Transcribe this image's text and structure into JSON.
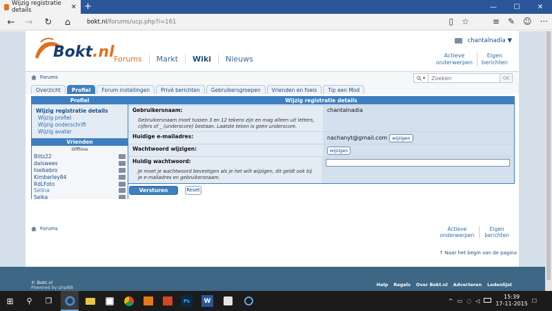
{
  "browser": {
    "tab_title": "Wijzig registratie details",
    "tab_close": "✕",
    "new_tab": "+",
    "url_host": "bokt.nl",
    "url_path": "/forums/ucp.php?i=161",
    "back": "←",
    "forward": "→",
    "refresh": "↻",
    "home": "⌂",
    "reading_view": "▯",
    "favorite": "☆",
    "hub": "≡",
    "note": "✎",
    "share": "☺",
    "more": "···",
    "minimize": "—",
    "maximize": "☐",
    "close": "✕"
  },
  "header": {
    "logo_text": "Bokt",
    "logo_suffix": ".nl",
    "nav": [
      "Forums",
      "Markt",
      "Wiki",
      "Nieuws"
    ],
    "username": "chantalnadia",
    "user_caret": "▼",
    "quick_links": [
      {
        "line1": "Actieve",
        "line2": "onderwerpen"
      },
      {
        "line1": "Eigen",
        "line2": "berichten"
      }
    ]
  },
  "subheader": {
    "breadcrumb": "Forums",
    "search_placeholder": "Zoeken",
    "search_ok": "OK",
    "search_icon_caret": "▾",
    "tabs": [
      "Overzicht",
      "Profiel",
      "Forum instellingen",
      "Privé berichten",
      "Gebruikersgroepen",
      "Vrienden en foeis",
      "Tip een Mod"
    ]
  },
  "left_panel": {
    "profile_heading": "Profiel",
    "links": [
      "Wijzig registratie details",
      "Wijzig profiel",
      "Wijzig onderschrift",
      "Wijzig avatar"
    ],
    "friends_heading": "Vrienden",
    "offline_label": "Offline",
    "friends": [
      "Blitz22",
      "daiswees",
      "hielkebro",
      "Kimberley84",
      "RdLFoto",
      "Selina",
      "Selka"
    ]
  },
  "form": {
    "heading": "Wijzig registratie details",
    "username_label": "Gebruikersnaam:",
    "username_hint": "Gebruikersnaam moet tussen 3 en 12 tekens zijn en mag alleen uit letters, cijfers of _ (underscore) bestaan. Laatste teken is geen underscore.",
    "username_value": "chantalnadia",
    "email_label": "Huidige e-mailadres:",
    "email_value": "nachanyt@gmail.com",
    "change_button": "wijzigen",
    "password_label": "Wachtwoord wijzigen:",
    "current_password_label": "Huidig wachtwoord:",
    "current_password_hint": "Je moet je wachtwoord bevestigen als je het wilt wijzigen, dit geldt ook bij je e-mailadres en gebruikersnaam.",
    "submit_label": "Versturen",
    "reset_label": "Reset"
  },
  "footer": {
    "breadcrumb": "Forums",
    "quick_links": [
      {
        "line1": "Actieve",
        "line2": "onderwerpen"
      },
      {
        "line1": "Eigen",
        "line2": "berichten"
      }
    ],
    "back_to_top": "↑ Naar het begin van de pagina",
    "copyright": "© Bokt.nl",
    "powered": "Powered by phpBB",
    "links": [
      "Help",
      "Regels",
      "Over Bokt.nl",
      "Adverteren",
      "Ledenlijst"
    ]
  },
  "taskbar": {
    "time": "15:39",
    "date": "17-11-2015",
    "start": "⊞",
    "search": "⚲",
    "taskview": "❐",
    "ps_label": "Ps",
    "word_label": "W",
    "tray_up": "^",
    "battery": "▭",
    "network": "◌",
    "volume": "◁",
    "notifications": "☐"
  },
  "colors": {
    "accent": "#3d7fc0",
    "brand_orange": "#e07020",
    "brand_navy": "#173d6e",
    "page_bg": "#d5dfe9",
    "footer_bg": "#3d6784"
  }
}
